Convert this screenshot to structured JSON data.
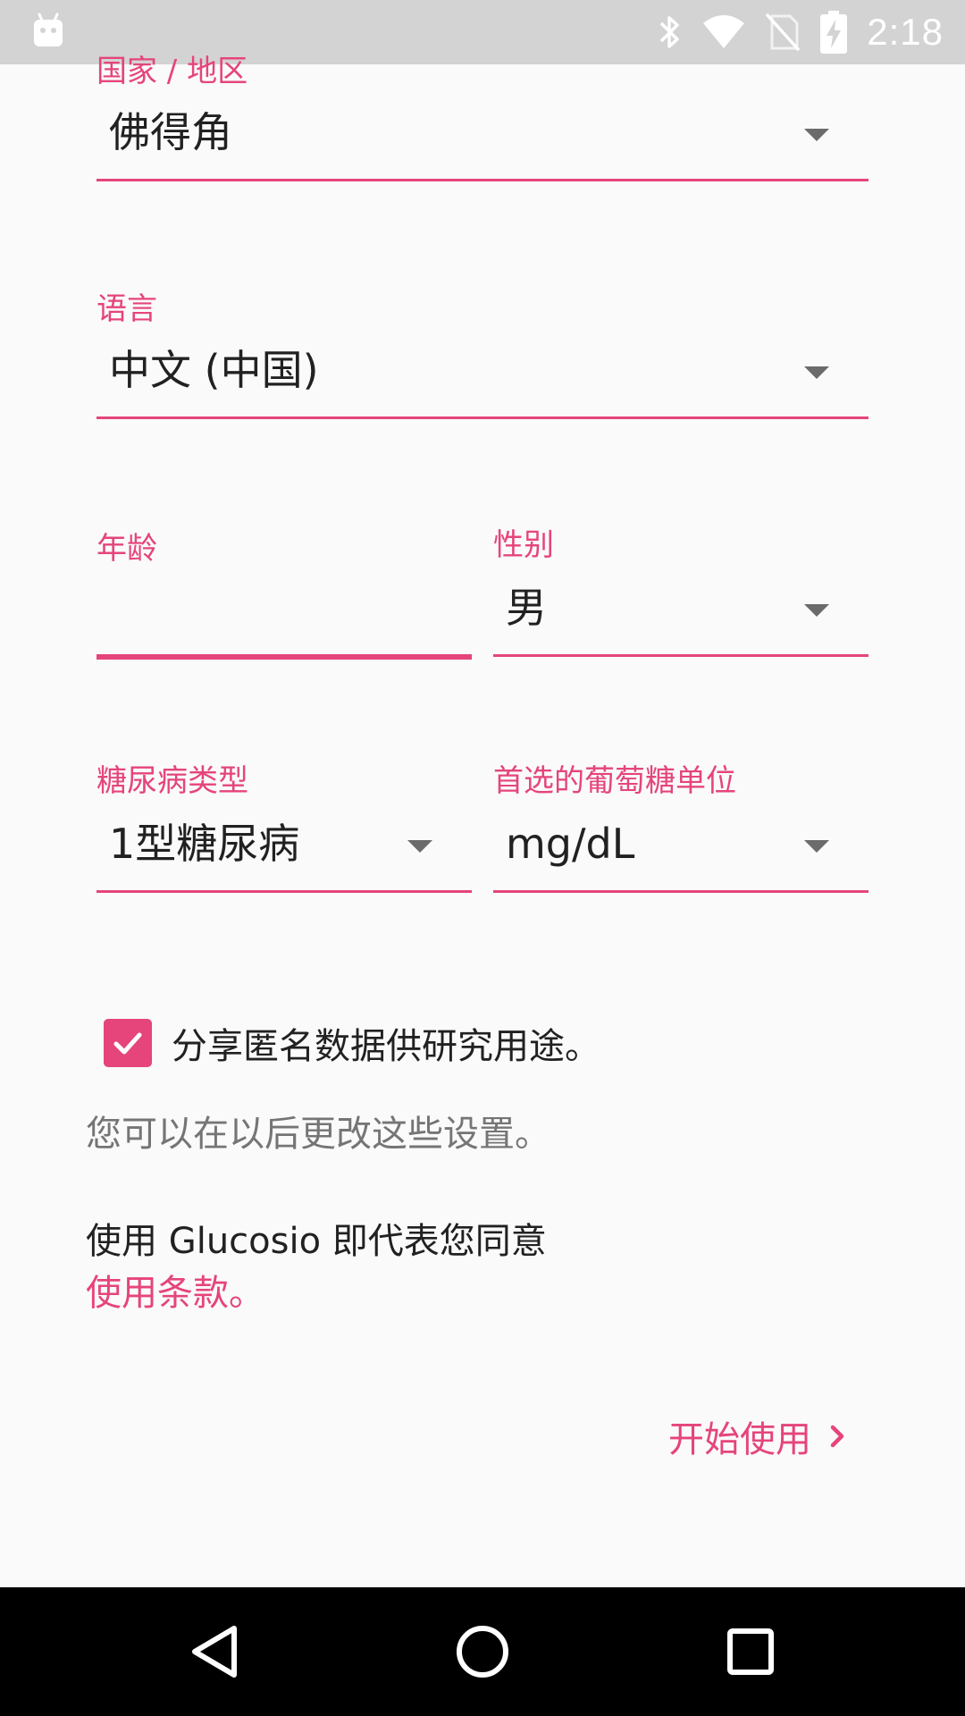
{
  "status_bar": {
    "time": "2:18",
    "icons": [
      "android-debug-icon",
      "bluetooth-icon",
      "wifi-icon",
      "no-sim-icon",
      "battery-charging-icon"
    ]
  },
  "form": {
    "country": {
      "label": "国家 / 地区",
      "value": "佛得角"
    },
    "language": {
      "label": "语言",
      "value": "中文 (中国)"
    },
    "age": {
      "label": "年龄",
      "value": ""
    },
    "gender": {
      "label": "性别",
      "value": "男"
    },
    "diabetes_type": {
      "label": "糖尿病类型",
      "value": "1型糖尿病"
    },
    "glucose_unit": {
      "label": "首选的葡萄糖单位",
      "value": "mg/dL"
    }
  },
  "share_data": {
    "label": "分享匿名数据供研究用途。",
    "checked": true
  },
  "settings_note": "您可以在以后更改这些设置。",
  "terms": {
    "text": "使用 Glucosio 即代表您同意",
    "link": "使用条款。"
  },
  "start_button": {
    "label": "开始使用"
  },
  "colors": {
    "accent": "#e5457a",
    "status_bar": "#d3d3d3",
    "nav_bar": "#000000",
    "background": "#fafafa"
  }
}
